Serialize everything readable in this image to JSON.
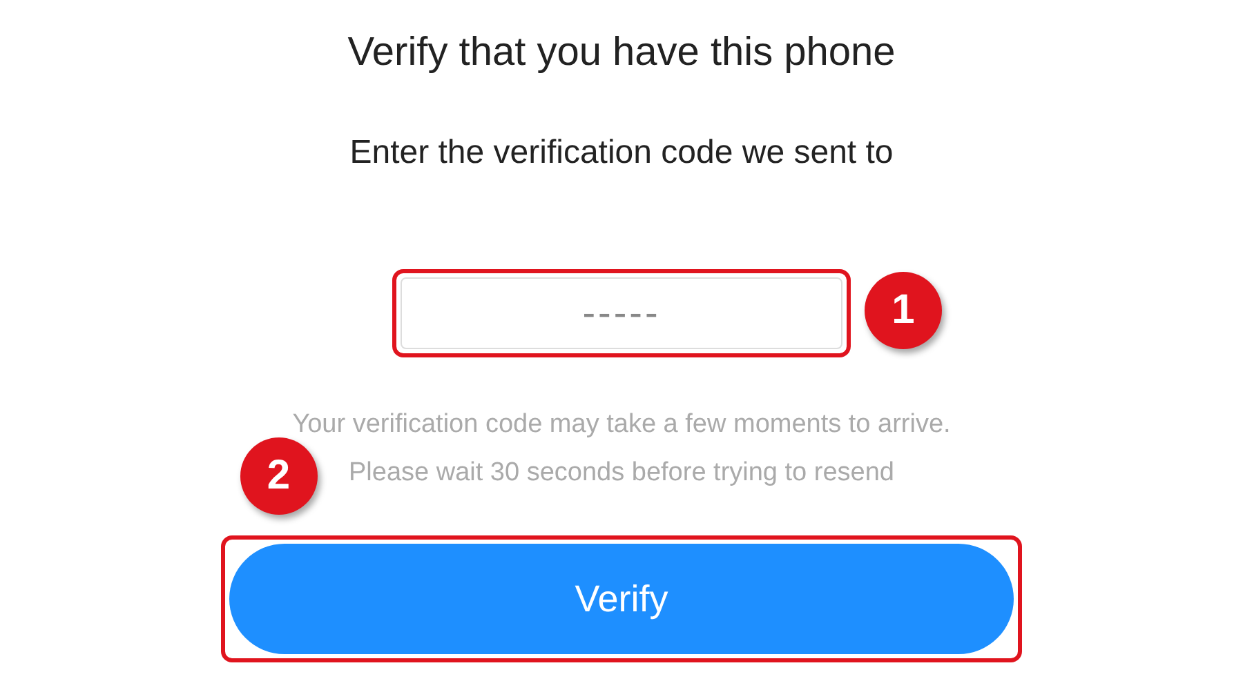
{
  "title": "Verify that you have this phone",
  "subtitle": "Enter the verification code we sent to",
  "code_field": {
    "placeholder": "-----"
  },
  "hints": [
    "Your verification code may take a few moments to arrive.",
    "Please wait 30 seconds before trying to resend"
  ],
  "verify_button": {
    "label": "Verify"
  },
  "callouts": [
    {
      "number": "1"
    },
    {
      "number": "2"
    }
  ]
}
